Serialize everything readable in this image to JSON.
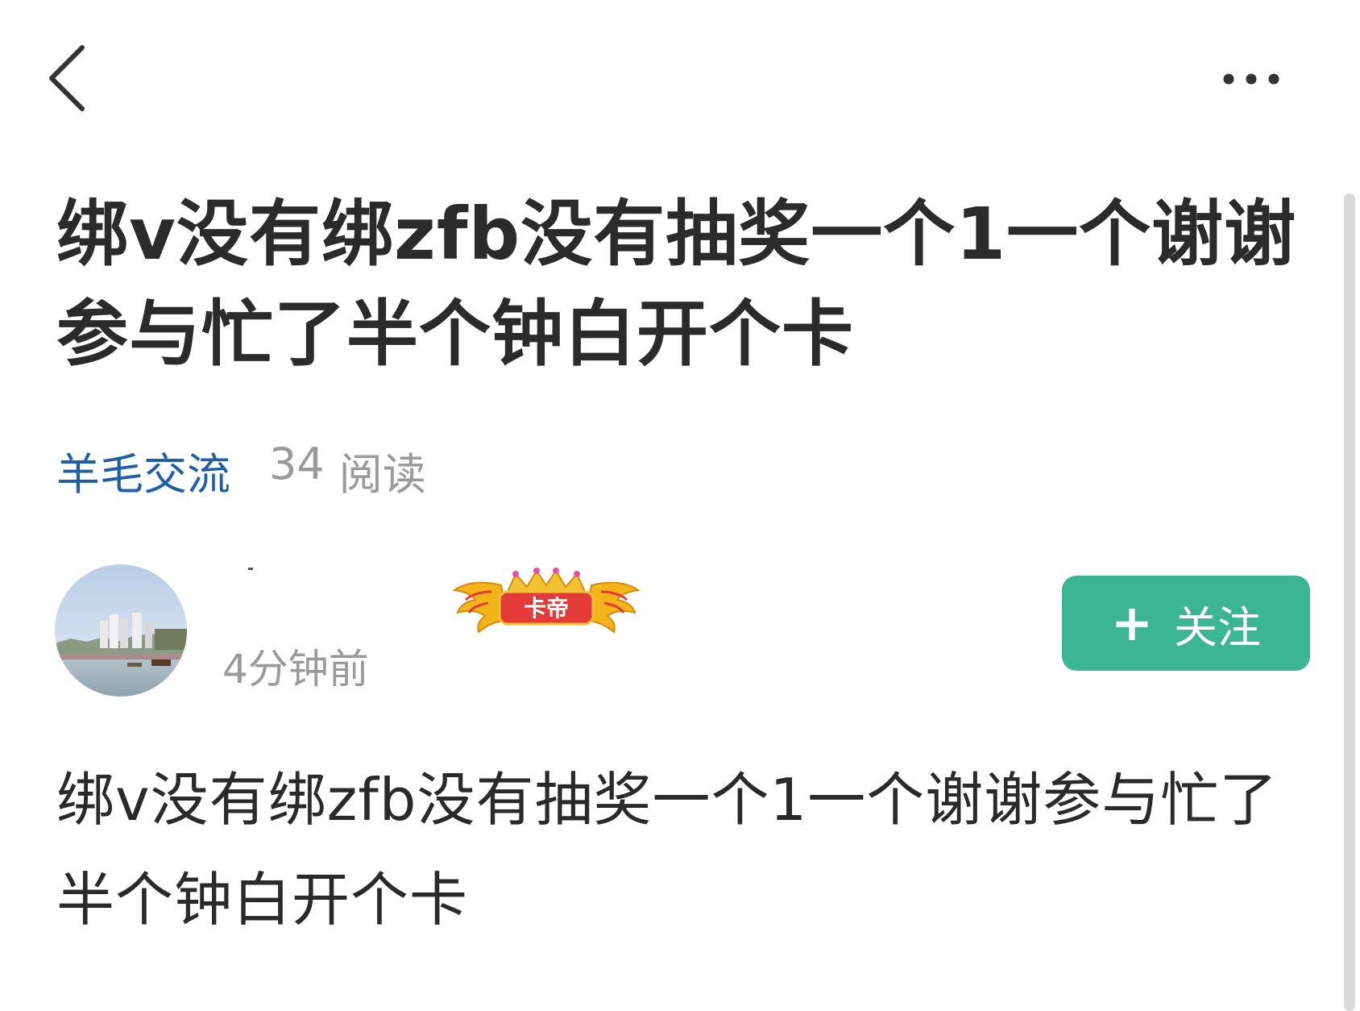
{
  "icons": {
    "back": "chevron-left-icon",
    "more": "more-dots-icon",
    "badge": "crown-wings-badge",
    "follow": "plus-icon"
  },
  "colors": {
    "category": "#1f5fa8",
    "follow_button": "#3bb68f",
    "muted_text": "#9a9a9a",
    "badge_red": "#e53a3a",
    "badge_gold": "#f2b418"
  },
  "post": {
    "title": "绑v没有绑zfb没有抽奖一个1一个谢谢参与忙了半个钟白开个卡",
    "category": "羊毛交流",
    "read_count": "34",
    "read_label": "阅读",
    "body": "绑v没有绑zfb没有抽奖一个1一个谢谢参与忙了半个钟白开个卡"
  },
  "author": {
    "badge_text": "卡帝",
    "time": "4分钟前",
    "follow_label": "关注"
  }
}
